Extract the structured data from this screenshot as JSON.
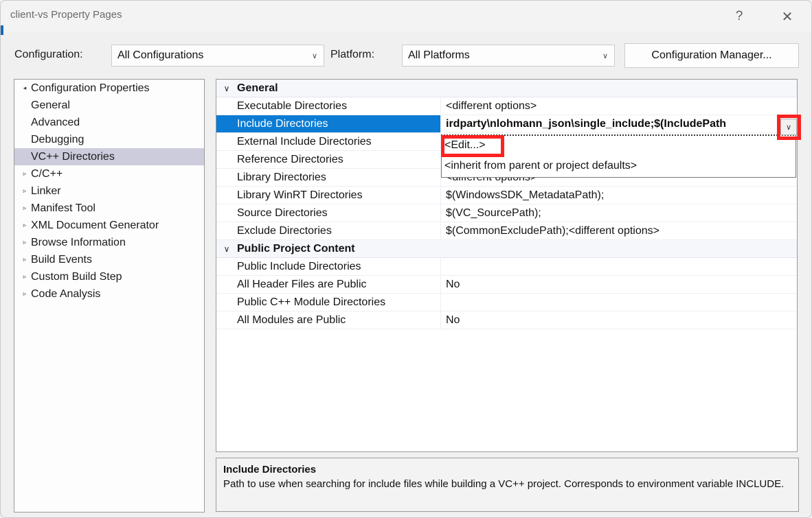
{
  "window": {
    "title": "client-vs Property Pages",
    "help_icon": "?",
    "close_icon": "✕"
  },
  "toolbar": {
    "configuration_label": "Configuration:",
    "configuration_value": "All Configurations",
    "platform_label": "Platform:",
    "platform_value": "All Platforms",
    "configuration_manager_label": "Configuration Manager...",
    "chevron_icon": "∨"
  },
  "tree": {
    "items": [
      {
        "label": "Configuration Properties",
        "level": 0,
        "expander": "◂",
        "selected": false
      },
      {
        "label": "General",
        "level": 1,
        "expander": "",
        "selected": false
      },
      {
        "label": "Advanced",
        "level": 1,
        "expander": "",
        "selected": false
      },
      {
        "label": "Debugging",
        "level": 1,
        "expander": "",
        "selected": false
      },
      {
        "label": "VC++ Directories",
        "level": 1,
        "expander": "",
        "selected": true
      },
      {
        "label": "C/C++",
        "level": 1,
        "expander": "▹",
        "selected": false
      },
      {
        "label": "Linker",
        "level": 1,
        "expander": "▹",
        "selected": false
      },
      {
        "label": "Manifest Tool",
        "level": 1,
        "expander": "▹",
        "selected": false
      },
      {
        "label": "XML Document Generator",
        "level": 1,
        "expander": "▹",
        "selected": false
      },
      {
        "label": "Browse Information",
        "level": 1,
        "expander": "▹",
        "selected": false
      },
      {
        "label": "Build Events",
        "level": 1,
        "expander": "▹",
        "selected": false
      },
      {
        "label": "Custom Build Step",
        "level": 1,
        "expander": "▹",
        "selected": false
      },
      {
        "label": "Code Analysis",
        "level": 1,
        "expander": "▹",
        "selected": false
      }
    ]
  },
  "grid": {
    "collapse_icon": "∨",
    "rows": [
      {
        "type": "category",
        "name": "General",
        "value": "",
        "selected": false
      },
      {
        "type": "property",
        "name": "Executable Directories",
        "value": "<different options>",
        "selected": false
      },
      {
        "type": "property",
        "name": "Include Directories",
        "value": "irdparty\\nlohmann_json\\single_include;$(IncludePath",
        "selected": true
      },
      {
        "type": "property",
        "name": "External Include Directories",
        "value": "",
        "selected": false
      },
      {
        "type": "property",
        "name": "Reference Directories",
        "value": "",
        "selected": false
      },
      {
        "type": "property",
        "name": "Library Directories",
        "value": "<different options>",
        "selected": false
      },
      {
        "type": "property",
        "name": "Library WinRT Directories",
        "value": "$(WindowsSDK_MetadataPath);",
        "selected": false
      },
      {
        "type": "property",
        "name": "Source Directories",
        "value": "$(VC_SourcePath);",
        "selected": false
      },
      {
        "type": "property",
        "name": "Exclude Directories",
        "value": "$(CommonExcludePath);<different options>",
        "selected": false
      },
      {
        "type": "category",
        "name": "Public Project Content",
        "value": "",
        "selected": false
      },
      {
        "type": "property",
        "name": "Public Include Directories",
        "value": "",
        "selected": false
      },
      {
        "type": "property",
        "name": "All Header Files are Public",
        "value": "No",
        "selected": false
      },
      {
        "type": "property",
        "name": "Public C++ Module Directories",
        "value": "",
        "selected": false
      },
      {
        "type": "property",
        "name": "All Modules are Public",
        "value": "No",
        "selected": false
      }
    ]
  },
  "value_dropdown": {
    "button_icon": "∨",
    "options": [
      "<Edit...>",
      "<inherit from parent or project defaults>"
    ]
  },
  "description": {
    "title": "Include Directories",
    "body": "Path to use when searching for include files while building a VC++ project.  Corresponds to environment variable INCLUDE."
  },
  "colors": {
    "selection_blue": "#0c7bd4",
    "tree_selection": "#ccccdd",
    "annotation_red": "#fc2222",
    "category_band": "#f5f7fb"
  }
}
